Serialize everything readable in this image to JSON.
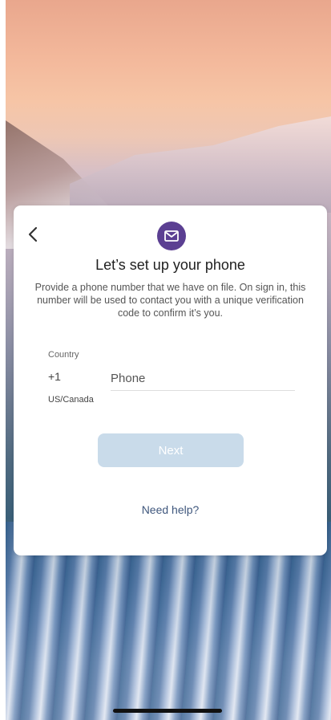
{
  "header": {
    "title": "Let’s set up your phone",
    "description": "Provide a phone number that we have on file. On sign in, this number will be used to contact you with a unique verification code to confirm it’s you."
  },
  "country": {
    "label": "Country",
    "code": "+1",
    "name": "US/Canada"
  },
  "phone": {
    "placeholder": "Phone",
    "value": ""
  },
  "actions": {
    "next_label": "Next",
    "help_label": "Need help?"
  },
  "icons": {
    "back": "chevron-left-icon",
    "logo": "envelope-icon"
  },
  "colors": {
    "logo_bg": "#5b3f92",
    "next_bg": "#c9dbea",
    "help_text": "#3f577d"
  }
}
